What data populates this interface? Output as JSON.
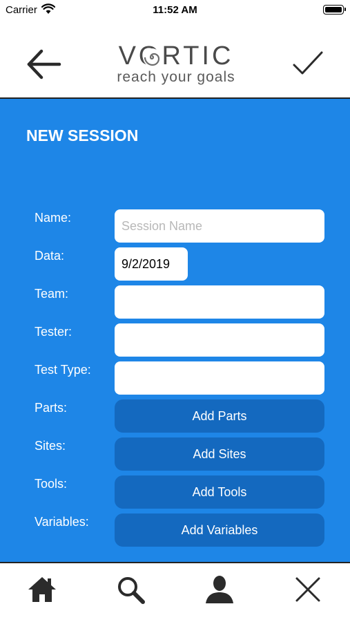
{
  "status": {
    "carrier": "Carrier",
    "time": "11:52 AM"
  },
  "header": {
    "logo_word": "VORTIC",
    "logo_tagline": "reach your goals",
    "back_icon": "arrow-left-icon",
    "confirm_icon": "checkmark-icon"
  },
  "form": {
    "title": "NEW SESSION",
    "name_label": "Name:",
    "name_placeholder": "Session Name",
    "name_value": "",
    "date_label": "Data:",
    "date_value": "9/2/2019",
    "team_label": "Team:",
    "team_value": "",
    "tester_label": "Tester:",
    "tester_value": "",
    "test_type_label": "Test Type:",
    "test_type_value": "",
    "parts_label": "Parts:",
    "parts_button": "Add Parts",
    "sites_label": "Sites:",
    "sites_button": "Add Sites",
    "tools_label": "Tools:",
    "tools_button": "Add Tools",
    "variables_label": "Variables:",
    "variables_button": "Add Variables"
  },
  "tabbar": {
    "items": [
      "home-icon",
      "search-icon",
      "user-icon",
      "close-icon"
    ]
  },
  "colors": {
    "panel": "#1e86e7",
    "button": "#1469bf",
    "text_on_panel": "#ffffff"
  }
}
